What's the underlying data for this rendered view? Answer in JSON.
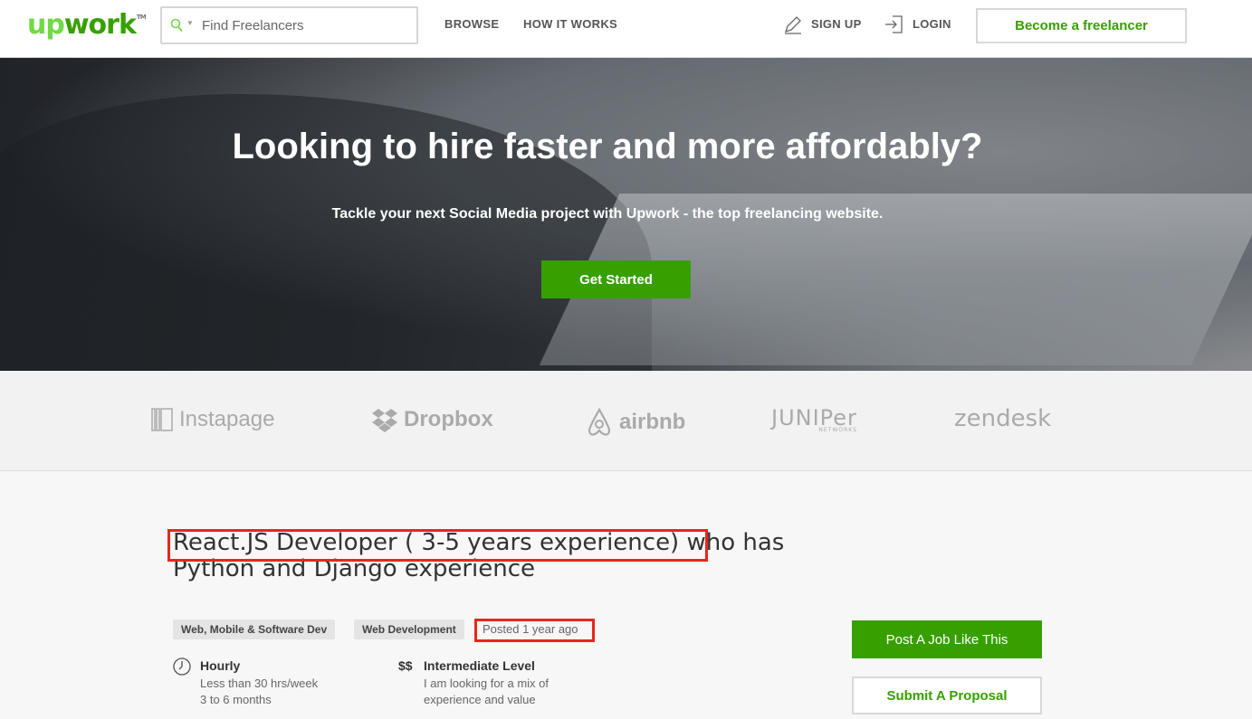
{
  "header": {
    "logo_up": "up",
    "logo_work": "work",
    "logo_tm": "TM",
    "search": {
      "placeholder": "Find Freelancers"
    },
    "nav": {
      "browse": "BROWSE",
      "how_it_works": "HOW IT WORKS",
      "sign_up": "SIGN UP",
      "login": "LOGIN"
    },
    "become_freelancer": "Become a freelancer"
  },
  "hero": {
    "title": "Looking to hire faster and more affordably?",
    "subtitle": "Tackle your next Social Media project with Upwork - the top freelancing website.",
    "cta": "Get Started"
  },
  "logos": {
    "instapage": "Instapage",
    "dropbox": "Dropbox",
    "airbnb": "airbnb",
    "juniper": "JUNIPer",
    "juniper_sub": "NETWORKS",
    "zendesk": "zendesk"
  },
  "job": {
    "title": "React.JS Developer ( 3-5 years experience) who has Python and Django experience",
    "tags": [
      "Web, Mobile & Software Dev",
      "Web Development"
    ],
    "posted": "Posted 1 year ago",
    "hourly": {
      "heading": "Hourly",
      "lines": [
        "Less than 30 hrs/week",
        "3 to 6 months"
      ]
    },
    "level": {
      "symbol": "$$",
      "heading": "Intermediate Level",
      "lines": [
        "I am looking for a mix of",
        "experience and value"
      ]
    },
    "post_job": "Post A Job Like This",
    "submit_proposal": "Submit A Proposal"
  },
  "colors": {
    "brand_green": "#37a000",
    "logo_light_green": "#6fda44",
    "highlight_red": "#e8261b"
  }
}
